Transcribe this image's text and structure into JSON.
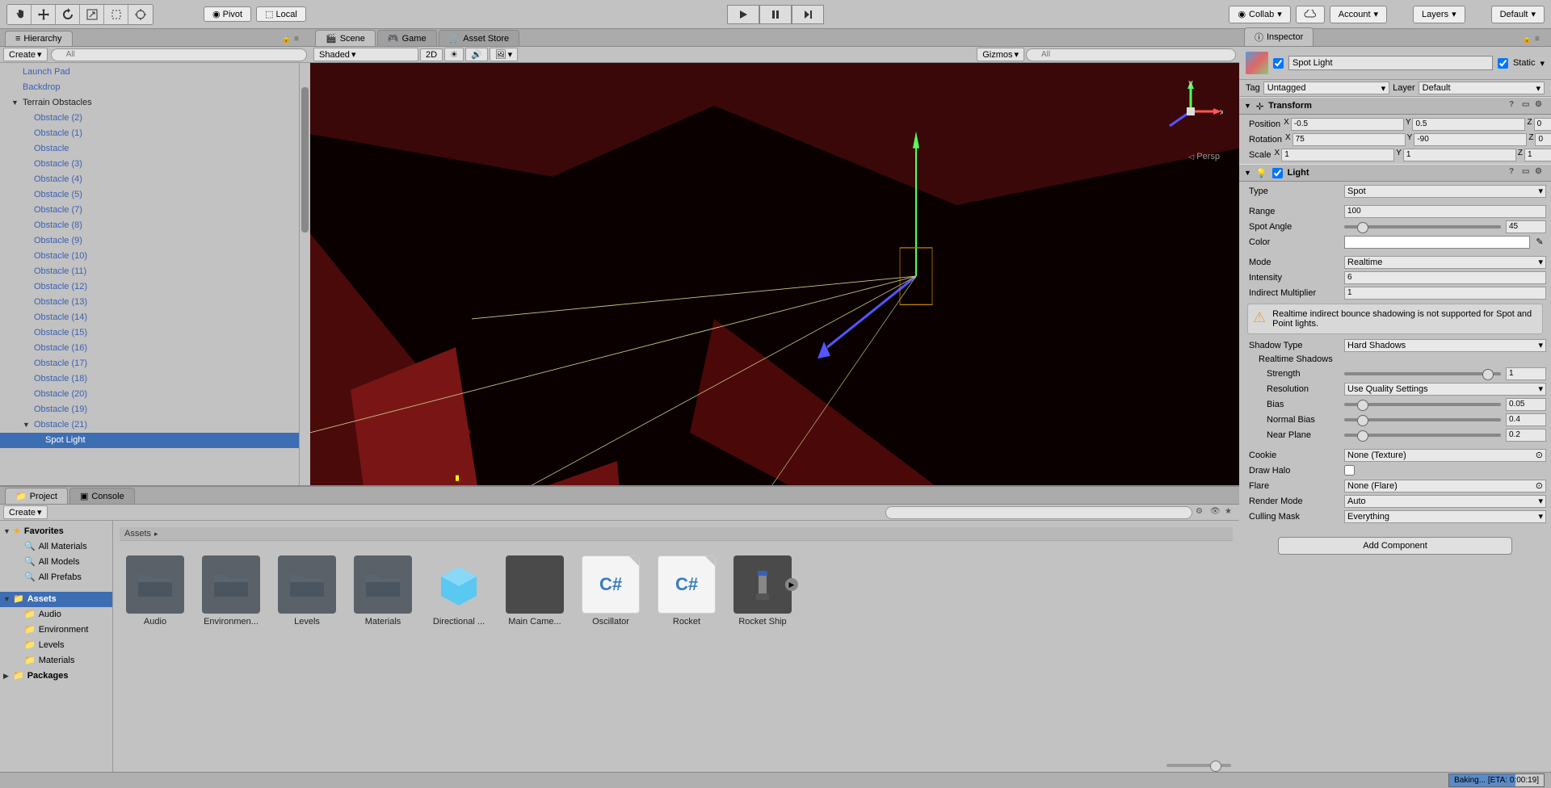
{
  "toolbar": {
    "pivot": "Pivot",
    "local": "Local",
    "collab": "Collab",
    "account": "Account",
    "layers": "Layers",
    "layout": "Default"
  },
  "hierarchy": {
    "title": "Hierarchy",
    "create": "Create",
    "search_ph": "All",
    "items": [
      {
        "label": "Launch Pad",
        "lv": 1
      },
      {
        "label": "Backdrop",
        "lv": 1
      },
      {
        "label": "Terrain Obstacles",
        "lv": 1,
        "arrow": true,
        "header": true
      },
      {
        "label": "Obstacle (2)",
        "lv": 2
      },
      {
        "label": "Obstacle (1)",
        "lv": 2
      },
      {
        "label": "Obstacle",
        "lv": 2
      },
      {
        "label": "Obstacle (3)",
        "lv": 2
      },
      {
        "label": "Obstacle (4)",
        "lv": 2
      },
      {
        "label": "Obstacle (5)",
        "lv": 2
      },
      {
        "label": "Obstacle (7)",
        "lv": 2
      },
      {
        "label": "Obstacle (8)",
        "lv": 2
      },
      {
        "label": "Obstacle (9)",
        "lv": 2
      },
      {
        "label": "Obstacle (10)",
        "lv": 2
      },
      {
        "label": "Obstacle (11)",
        "lv": 2
      },
      {
        "label": "Obstacle (12)",
        "lv": 2
      },
      {
        "label": "Obstacle (13)",
        "lv": 2
      },
      {
        "label": "Obstacle (14)",
        "lv": 2
      },
      {
        "label": "Obstacle (15)",
        "lv": 2
      },
      {
        "label": "Obstacle (16)",
        "lv": 2
      },
      {
        "label": "Obstacle (17)",
        "lv": 2
      },
      {
        "label": "Obstacle (18)",
        "lv": 2
      },
      {
        "label": "Obstacle (20)",
        "lv": 2
      },
      {
        "label": "Obstacle (19)",
        "lv": 2
      },
      {
        "label": "Obstacle (21)",
        "lv": 2,
        "arrow": true
      },
      {
        "label": "Spot Light",
        "lv": 3,
        "sel": true
      }
    ]
  },
  "scene": {
    "tabs": [
      "Scene",
      "Game",
      "Asset Store"
    ],
    "shaded": "Shaded",
    "mode2d": "2D",
    "gizmos": "Gizmos",
    "search_ph": "All",
    "persp": "Persp",
    "axis_x": "x",
    "axis_y": "y"
  },
  "project": {
    "tabs": [
      "Project",
      "Console"
    ],
    "create": "Create",
    "breadcrumb": "Assets",
    "tree": {
      "favorites": "Favorites",
      "fav_items": [
        "All Materials",
        "All Models",
        "All Prefabs"
      ],
      "assets": "Assets",
      "asset_items": [
        "Audio",
        "Environment",
        "Levels",
        "Materials"
      ],
      "packages": "Packages"
    },
    "items": [
      {
        "label": "Audio",
        "type": "folder"
      },
      {
        "label": "Environmen...",
        "type": "folder"
      },
      {
        "label": "Levels",
        "type": "folder"
      },
      {
        "label": "Materials",
        "type": "folder"
      },
      {
        "label": "Directional ...",
        "type": "prefab"
      },
      {
        "label": "Main Came...",
        "type": "dark"
      },
      {
        "label": "Oscillator",
        "type": "cs"
      },
      {
        "label": "Rocket",
        "type": "cs"
      },
      {
        "label": "Rocket Ship",
        "type": "dark"
      }
    ]
  },
  "inspector": {
    "title": "Inspector",
    "name": "Spot Light",
    "static": "Static",
    "tag": "Tag",
    "tag_val": "Untagged",
    "layer": "Layer",
    "layer_val": "Default",
    "transform": {
      "title": "Transform",
      "pos": "Position",
      "px": "-0.5",
      "py": "0.5",
      "pz": "0",
      "rot": "Rotation",
      "rx": "75",
      "ry": "-90",
      "rz": "0",
      "scale": "Scale",
      "sx": "1",
      "sy": "1",
      "sz": "1"
    },
    "light": {
      "title": "Light",
      "type": "Type",
      "type_val": "Spot",
      "range": "Range",
      "range_val": "100",
      "spot": "Spot Angle",
      "spot_val": "45",
      "color": "Color",
      "mode": "Mode",
      "mode_val": "Realtime",
      "intensity": "Intensity",
      "intensity_val": "6",
      "indirect": "Indirect Multiplier",
      "indirect_val": "1",
      "warn": "Realtime indirect bounce shadowing is not supported for Spot and Point lights.",
      "shadow": "Shadow Type",
      "shadow_val": "Hard Shadows",
      "realtime": "Realtime Shadows",
      "strength": "Strength",
      "strength_val": "1",
      "resolution": "Resolution",
      "resolution_val": "Use Quality Settings",
      "bias": "Bias",
      "bias_val": "0.05",
      "normal_bias": "Normal Bias",
      "normal_bias_val": "0.4",
      "near": "Near Plane",
      "near_val": "0.2",
      "cookie": "Cookie",
      "cookie_val": "None (Texture)",
      "draw_halo": "Draw Halo",
      "flare": "Flare",
      "flare_val": "None (Flare)",
      "render": "Render Mode",
      "render_val": "Auto",
      "culling": "Culling Mask",
      "culling_val": "Everything"
    },
    "add_component": "Add Component"
  },
  "status": {
    "baking": "Baking... [ETA: 0:00:19]"
  }
}
